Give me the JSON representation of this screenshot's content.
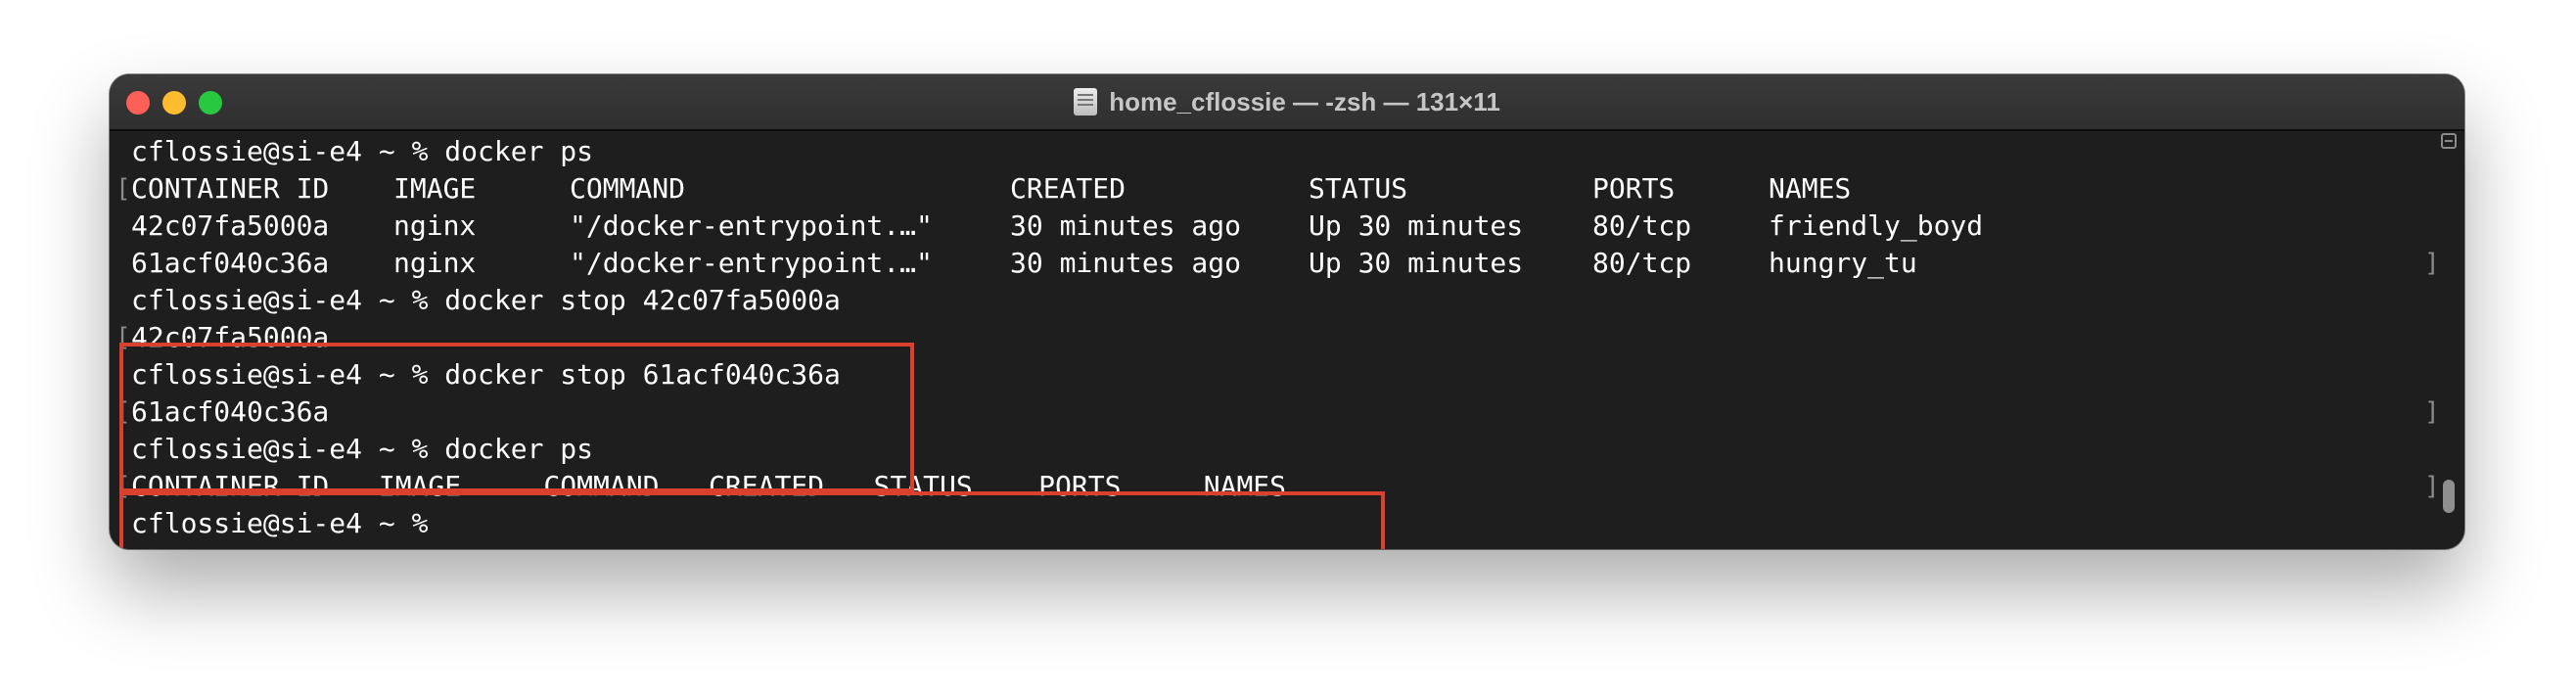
{
  "window": {
    "title": "home_cflossie — -zsh — 131×11",
    "icon": "document-icon",
    "traffic_lights": {
      "close_color": "#fe5f57",
      "minimize_color": "#febc2e",
      "zoom_color": "#28c840"
    }
  },
  "colors": {
    "terminal_bg": "#1e1e1e",
    "terminal_text": "#ffffff",
    "highlight_border": "#d9412e"
  },
  "terminal": {
    "lines": [
      {
        "kind": "prompt",
        "text": "cflossie@si-e4 ~ % docker ps"
      },
      {
        "kind": "table-header",
        "cells": [
          "CONTAINER ID",
          "IMAGE",
          "COMMAND",
          "CREATED",
          "STATUS",
          "PORTS",
          "NAMES"
        ]
      },
      {
        "kind": "table-row",
        "cells": [
          "42c07fa5000a",
          "nginx",
          "\"/docker-entrypoint.…\"",
          "30 minutes ago",
          "Up 30 minutes",
          "80/tcp",
          "friendly_boyd"
        ]
      },
      {
        "kind": "table-row",
        "cells": [
          "61acf040c36a",
          "nginx",
          "\"/docker-entrypoint.…\"",
          "30 minutes ago",
          "Up 30 minutes",
          "80/tcp",
          "hungry_tu"
        ]
      },
      {
        "kind": "prompt",
        "text": "cflossie@si-e4 ~ % docker stop 42c07fa5000a"
      },
      {
        "kind": "output",
        "text": "42c07fa5000a"
      },
      {
        "kind": "prompt",
        "text": "cflossie@si-e4 ~ % docker stop 61acf040c36a"
      },
      {
        "kind": "output",
        "text": "61acf040c36a"
      },
      {
        "kind": "prompt",
        "text": "cflossie@si-e4 ~ % docker ps"
      },
      {
        "kind": "output",
        "text": "CONTAINER ID   IMAGE     COMMAND   CREATED   STATUS    PORTS     NAMES"
      },
      {
        "kind": "prompt-current",
        "text": "cflossie@si-e4 ~ %"
      }
    ]
  }
}
